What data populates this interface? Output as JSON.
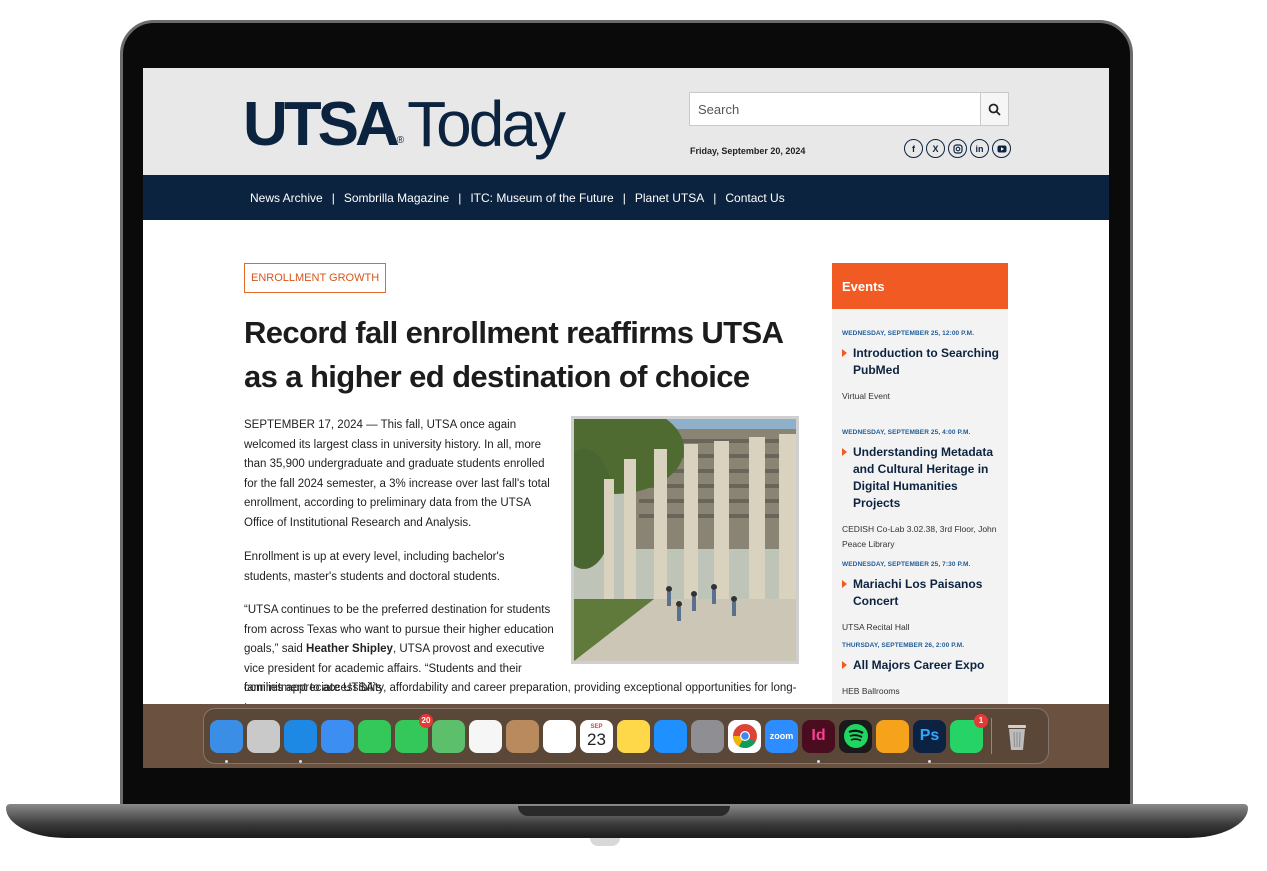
{
  "header": {
    "logo_main": "UTSA",
    "logo_reg": "®",
    "logo_sub": "Today",
    "search_placeholder": "Search",
    "date": "Friday, September 20, 2024",
    "social": [
      "facebook-icon",
      "x-icon",
      "instagram-icon",
      "linkedin-icon",
      "youtube-icon"
    ]
  },
  "nav": {
    "items": [
      "News Archive",
      "Sombrilla Magazine",
      "ITC: Museum of the Future",
      "Planet UTSA",
      "Contact Us"
    ]
  },
  "article": {
    "tag": "ENROLLMENT GROWTH",
    "headline": "Record fall enrollment reaffirms UTSA as a higher ed destination of choice",
    "p1": "SEPTEMBER 17, 2024 — This fall, UTSA once again welcomed its largest class in university history. In all, more than 35,900 undergraduate and graduate students enrolled for the fall 2024 semester, a 3% increase over last fall's total enrollment, according to preliminary data from the UTSA Office of Institutional Research and Analysis.",
    "p2": "Enrollment is up at every level, including bachelor's students, master's students and doctoral students.",
    "p3_start": "“UTSA continues to be the preferred destination for students from across Texas who want to pursue their higher education goals,” said ",
    "p3_name": "Heather Shipley",
    "p3_end": ", UTSA provost and executive vice president for academic affairs. “Students and their families appreciate UTSA's",
    "p4": "commitment to accessibility, affordability and career preparation, providing exceptional opportunities for long-term career"
  },
  "events": {
    "heading": "Events",
    "items": [
      {
        "date": "WEDNESDAY, SEPTEMBER 25, 12:00 P.M.",
        "title": "Introduction to Searching PubMed",
        "location": "Virtual Event"
      },
      {
        "date": "WEDNESDAY, SEPTEMBER 25, 4:00 P.M.",
        "title": "Understanding Metadata and Cultural Heritage in Digital Humanities Projects",
        "location": "CEDISH Co-Lab 3.02.38, 3rd Floor, John Peace Library"
      },
      {
        "date": "WEDNESDAY, SEPTEMBER 25, 7:30 P.M.",
        "title": "Mariachi Los Paisanos Concert",
        "location": "UTSA Recital Hall"
      },
      {
        "date": "THURSDAY, SEPTEMBER 26, 2:00 P.M.",
        "title": "All Majors Career Expo",
        "location": "HEB Ballrooms"
      }
    ]
  },
  "dock": {
    "apps": [
      {
        "name": "finder-icon",
        "color": "#3a8ee6"
      },
      {
        "name": "launchpad-icon",
        "color": "#c9c9c9"
      },
      {
        "name": "safari-icon",
        "color": "#1e88e5"
      },
      {
        "name": "mail-icon",
        "color": "#3d8ef2"
      },
      {
        "name": "facetime-icon",
        "color": "#34c759"
      },
      {
        "name": "messages-icon",
        "color": "#34c759",
        "badge": "20"
      },
      {
        "name": "maps-icon",
        "color": "#5cbf6b"
      },
      {
        "name": "photos-icon",
        "color": "#f6f6f6"
      },
      {
        "name": "contacts-icon",
        "color": "#b88a5e"
      },
      {
        "name": "reminders-icon",
        "color": "#ffffff"
      },
      {
        "name": "calendar-icon",
        "color": "#ffffff",
        "month": "SEP",
        "day": "23"
      },
      {
        "name": "notes-icon",
        "color": "#ffd84a"
      },
      {
        "name": "app-store-icon",
        "color": "#1e90ff"
      },
      {
        "name": "system-settings-icon",
        "color": "#8e8e93"
      },
      {
        "name": "chrome-icon",
        "color": "#ffffff"
      },
      {
        "name": "zoom-icon",
        "color": "#2d8cff",
        "label": "zoom"
      },
      {
        "name": "indesign-icon",
        "color": "#4a0d1f",
        "label": "Id"
      },
      {
        "name": "spotify-icon",
        "color": "#1a1a1a"
      },
      {
        "name": "pages-icon",
        "color": "#f7a21b"
      },
      {
        "name": "photoshop-icon",
        "color": "#0b2242",
        "label": "Ps"
      },
      {
        "name": "whatsapp-icon",
        "color": "#25d366",
        "badge": "1"
      }
    ],
    "trash": {
      "name": "trash-icon",
      "color": "#bdbdbd"
    }
  }
}
